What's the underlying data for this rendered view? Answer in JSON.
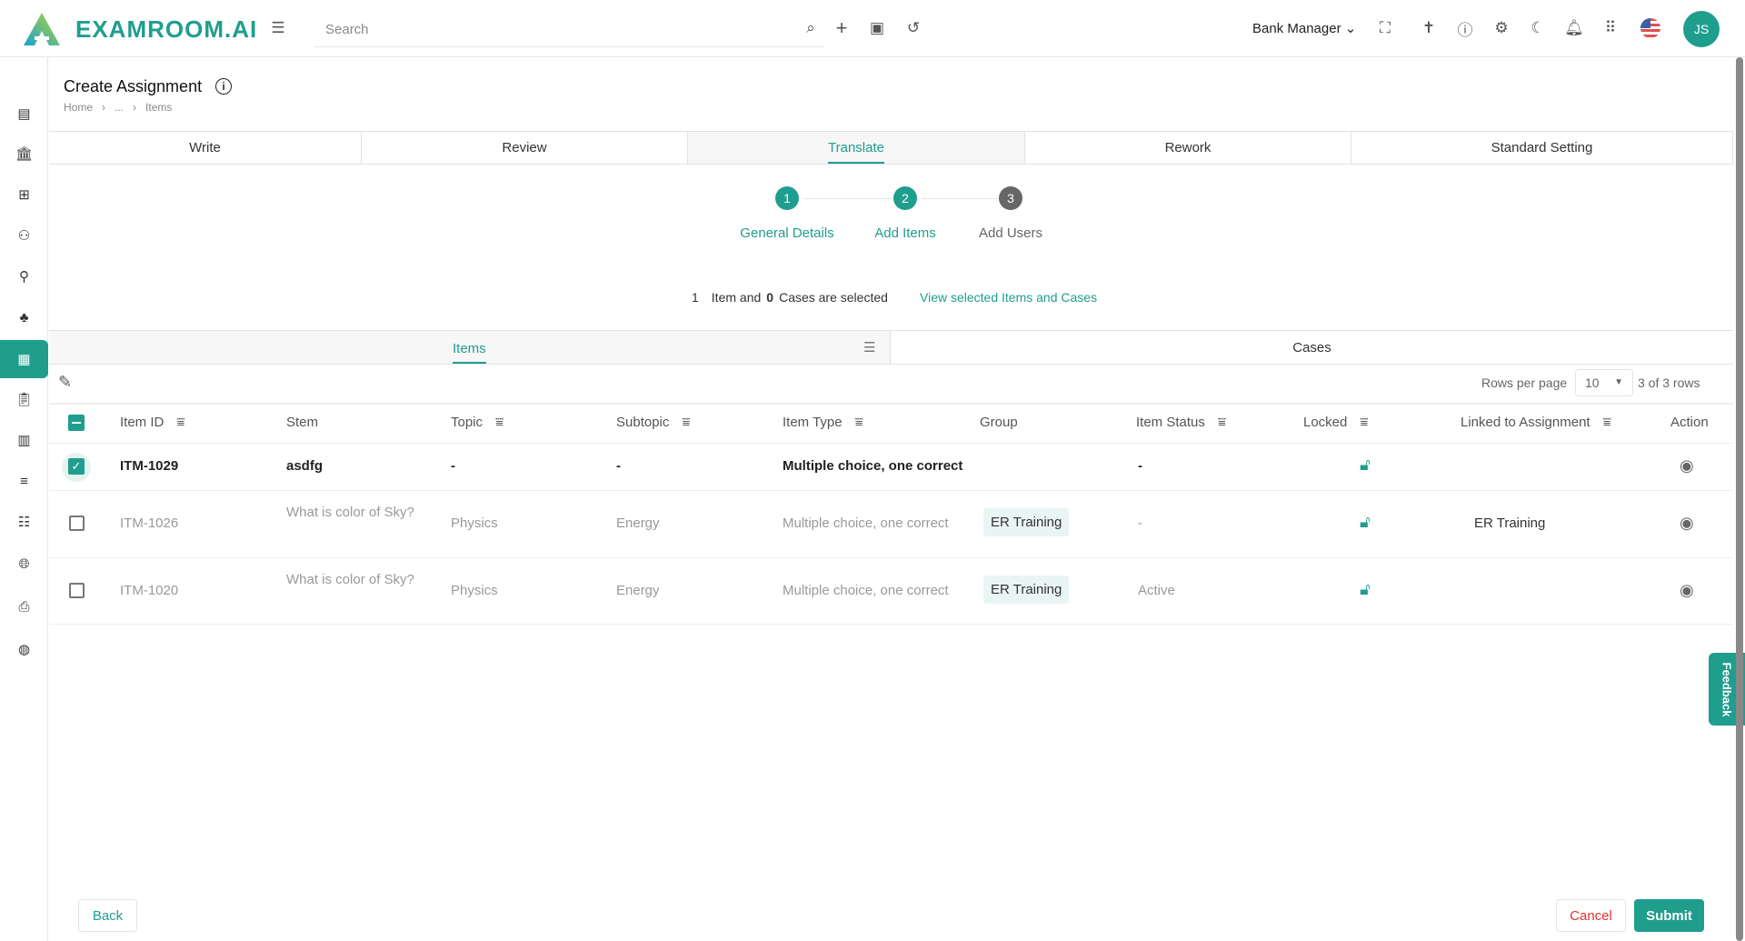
{
  "header": {
    "brand": "EXAMROOM.AI",
    "search_placeholder": "Search",
    "role": "Bank Manager",
    "avatar": "JS"
  },
  "page": {
    "title": "Create Assignment",
    "breadcrumb": [
      "Home",
      "...",
      "Items"
    ]
  },
  "tabs": [
    "Write",
    "Review",
    "Translate",
    "Rework",
    "Standard Setting"
  ],
  "active_tab": "Translate",
  "stepper": [
    {
      "num": "1",
      "label": "General Details"
    },
    {
      "num": "2",
      "label": "Add Items"
    },
    {
      "num": "3",
      "label": "Add Users"
    }
  ],
  "selection": {
    "items": "1",
    "items_text": "Item and",
    "cases": "0",
    "cases_text": "Cases are selected",
    "link": "View selected Items and Cases"
  },
  "subtabs": [
    "Items",
    "Cases"
  ],
  "pagination": {
    "label": "Rows per page",
    "value": "10",
    "count": "3 of 3 rows"
  },
  "columns": [
    "Item ID",
    "Stem",
    "Topic",
    "Subtopic",
    "Item Type",
    "Group",
    "Item Status",
    "Locked",
    "Linked to Assignment",
    "Action"
  ],
  "rows": [
    {
      "id": "ITM-1029",
      "stem": "asdfg",
      "topic": "-",
      "subtopic": "-",
      "type": "Multiple choice, one correct",
      "group": "",
      "status": "-",
      "linked": "",
      "checked": true
    },
    {
      "id": "ITM-1026",
      "stem": "What is color of Sky?",
      "topic": "Physics",
      "subtopic": "Energy",
      "type": "Multiple choice, one correct",
      "group": "ER Training",
      "status": "-",
      "linked": "ER Training",
      "checked": false
    },
    {
      "id": "ITM-1020",
      "stem": "What is color of Sky?",
      "topic": "Physics",
      "subtopic": "Energy",
      "type": "Multiple choice, one correct",
      "group": "ER Training",
      "status": "Active",
      "linked": "",
      "checked": false
    }
  ],
  "footer": {
    "back": "Back",
    "cancel": "Cancel",
    "submit": "Submit"
  },
  "feedback": "Feedback",
  "colors": {
    "accent": "#1f9e8e",
    "cancel": "#e03131"
  }
}
